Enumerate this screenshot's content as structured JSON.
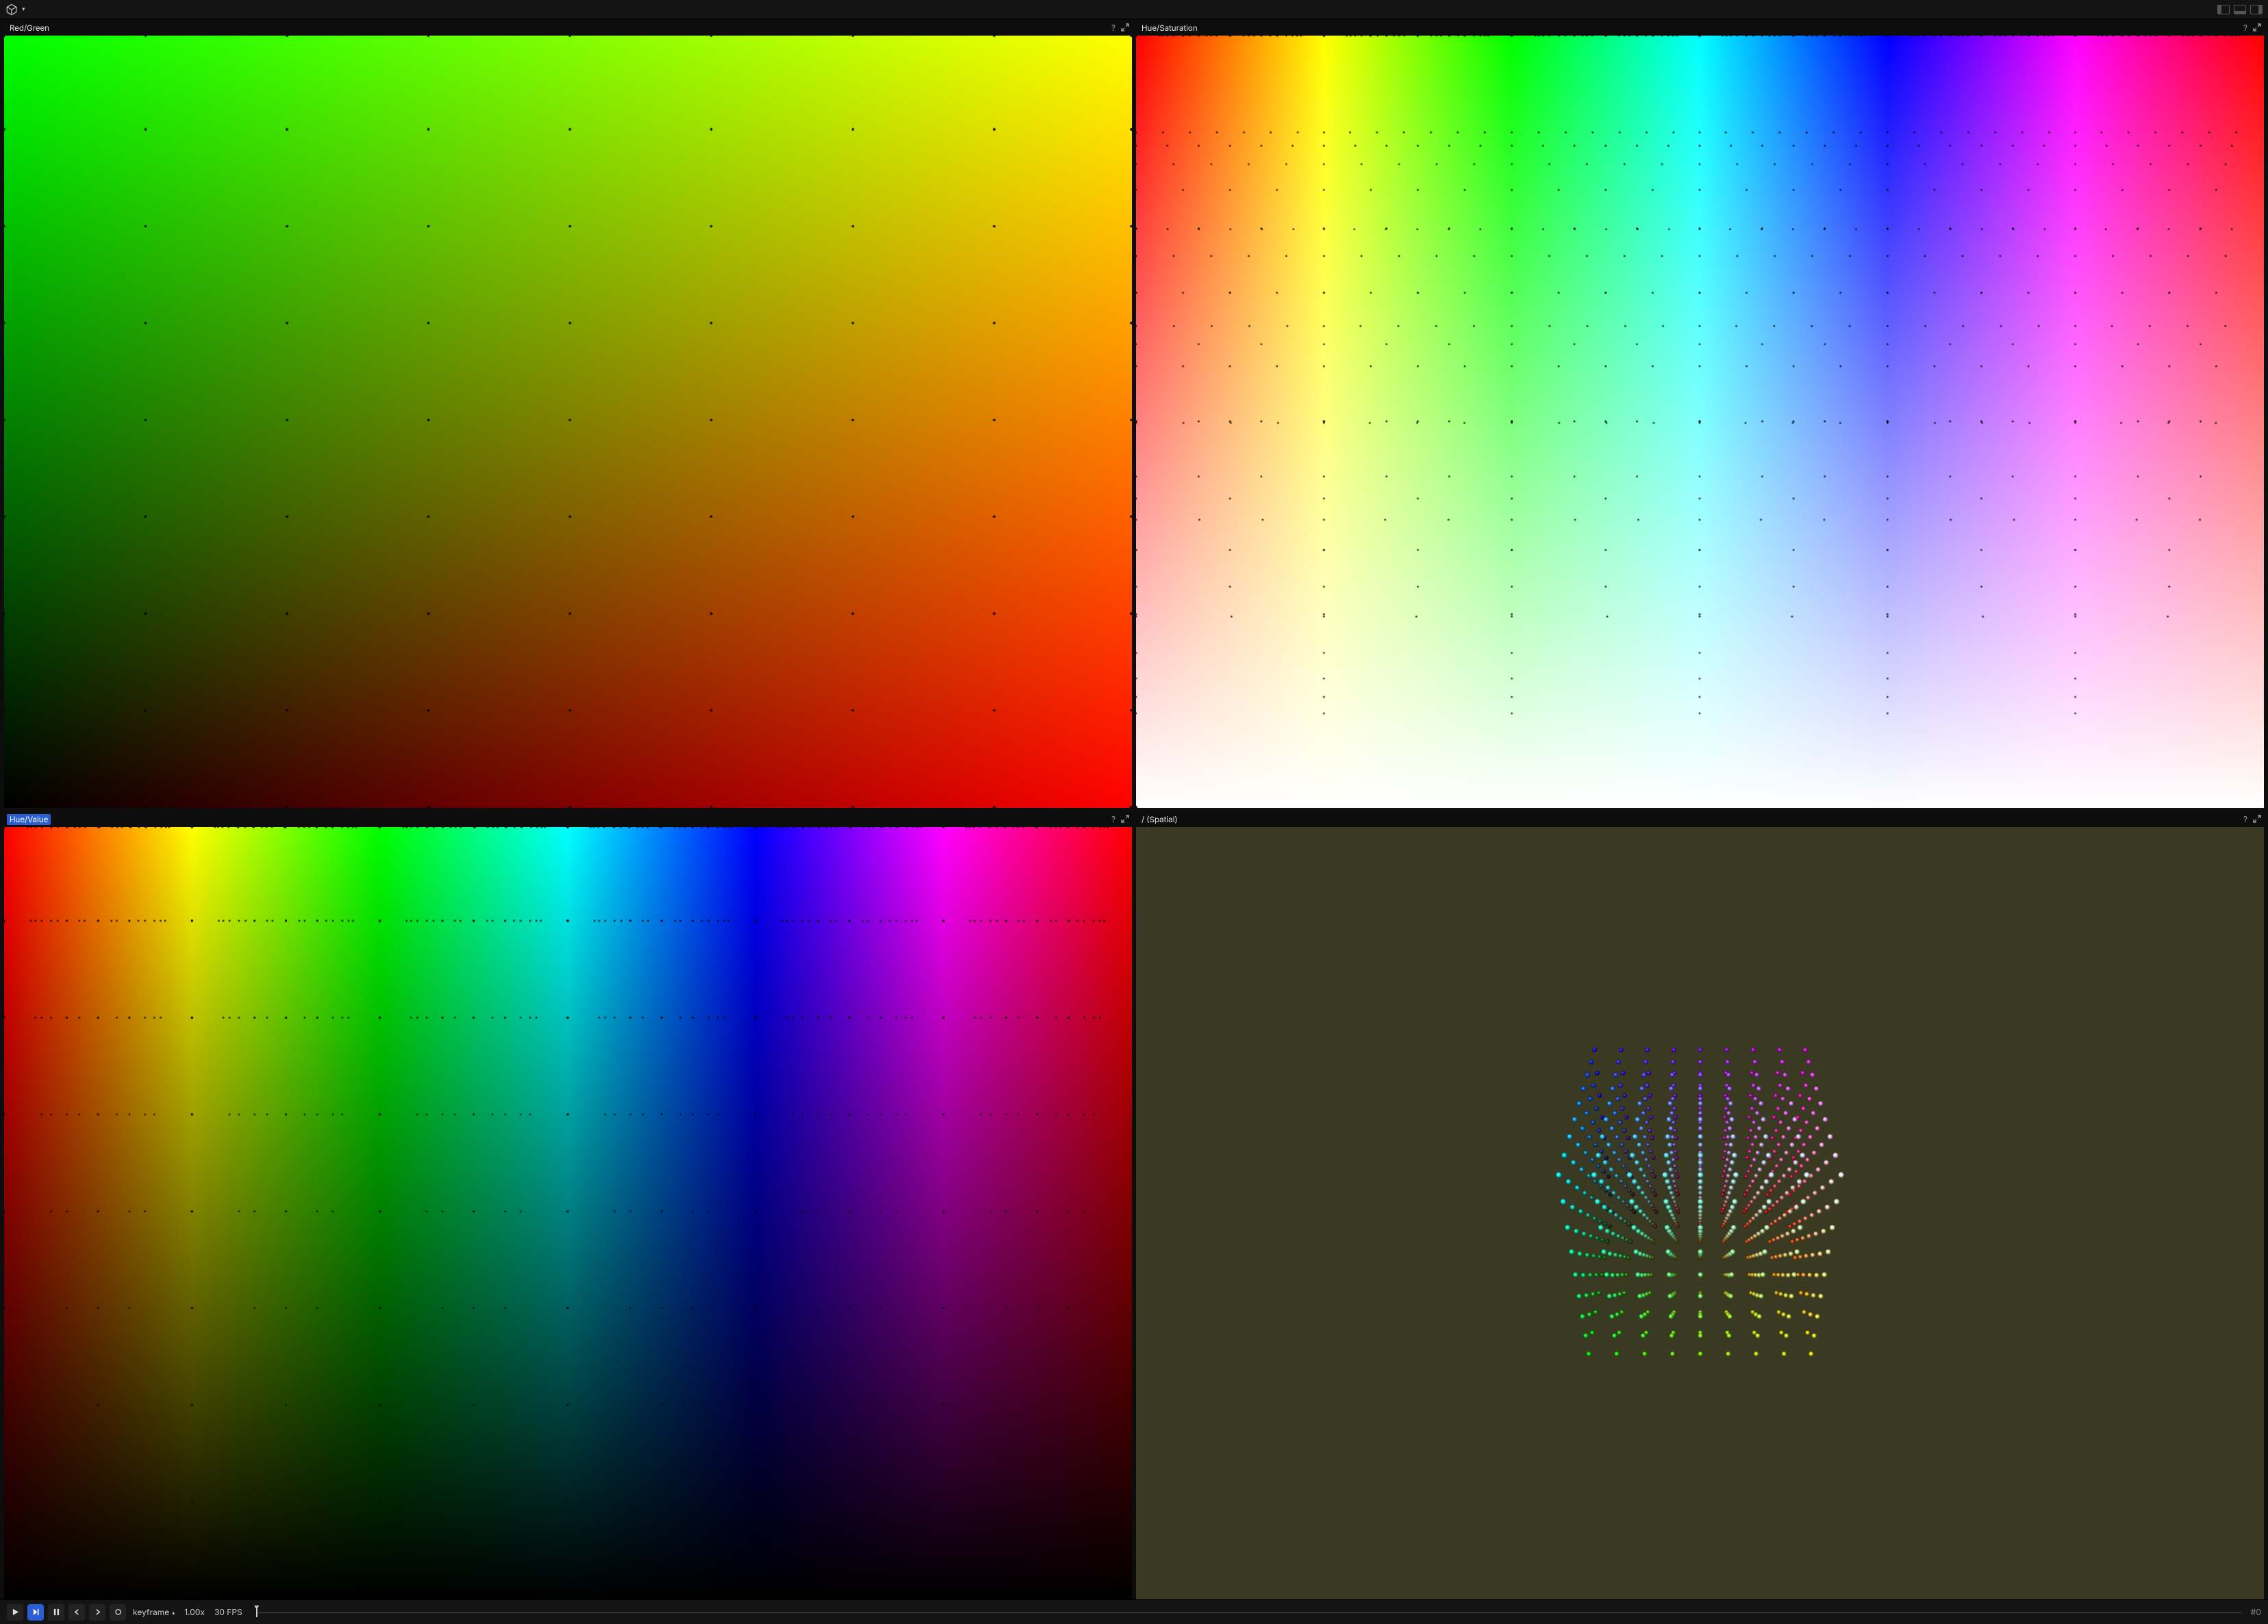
{
  "panels": {
    "top_left": {
      "title": "Red/Green",
      "selected": false
    },
    "top_right": {
      "title": "Hue/Saturation",
      "selected": false
    },
    "bottom_left": {
      "title": "Hue/Value",
      "selected": true
    },
    "bottom_right": {
      "title": "/ (Spatial)",
      "selected": false
    }
  },
  "timeline": {
    "mode_label": "keyframe",
    "speed": "1.00x",
    "fps": "30 FPS",
    "end_label": "#0"
  },
  "icons": {
    "help": "?",
    "caret_down": "▾",
    "caret_up": "▴"
  },
  "chart_data": {
    "description": "Four viewports visualizing the same 9×9×9 RGB point grid projected into different 2D color spaces plus one 3D spatial view.",
    "grid_steps_per_axis": 9,
    "step_values_0_255": [
      0,
      32,
      64,
      96,
      128,
      160,
      192,
      224,
      255
    ],
    "panels": [
      {
        "id": "top_left",
        "projection": "Red/Green",
        "x_axis": {
          "channel": "red",
          "range": [
            0,
            255
          ],
          "direction": "left→right"
        },
        "y_axis": {
          "channel": "green",
          "range": [
            0,
            255
          ],
          "direction": "bottom→top"
        },
        "background": "gradient over red (x) and green (y), blue fixed near 0",
        "overlaid_points": "all 729 RGB grid points as small black dots"
      },
      {
        "id": "top_right",
        "projection": "Hue/Saturation",
        "x_axis": {
          "channel": "hue",
          "range_deg": [
            0,
            360
          ],
          "direction": "left→right"
        },
        "y_axis": {
          "channel": "saturation",
          "range": [
            0,
            1
          ],
          "direction": "bottom→top"
        },
        "background": "HSV plane at value=1 (white at bottom, full hue band at top)",
        "overlaid_points": "RGB grid points converted to HSV and plotted; density highest along top edge"
      },
      {
        "id": "bottom_left",
        "projection": "Hue/Value",
        "x_axis": {
          "channel": "hue",
          "range_deg": [
            0,
            360
          ],
          "direction": "left→right"
        },
        "y_axis": {
          "channel": "value",
          "range": [
            0,
            1
          ],
          "direction": "bottom→top"
        },
        "background": "HSV plane at saturation=1 (black at bottom, full hue band at top)",
        "overlaid_points": "RGB grid points converted to HSV and plotted; points cluster on discrete value rows"
      },
      {
        "id": "bottom_right",
        "projection": "3D spatial",
        "description": "Perspective view of the 9×9×9 RGB cube rendered as colored spheres, camera above looking down, dark olive background"
      }
    ]
  }
}
